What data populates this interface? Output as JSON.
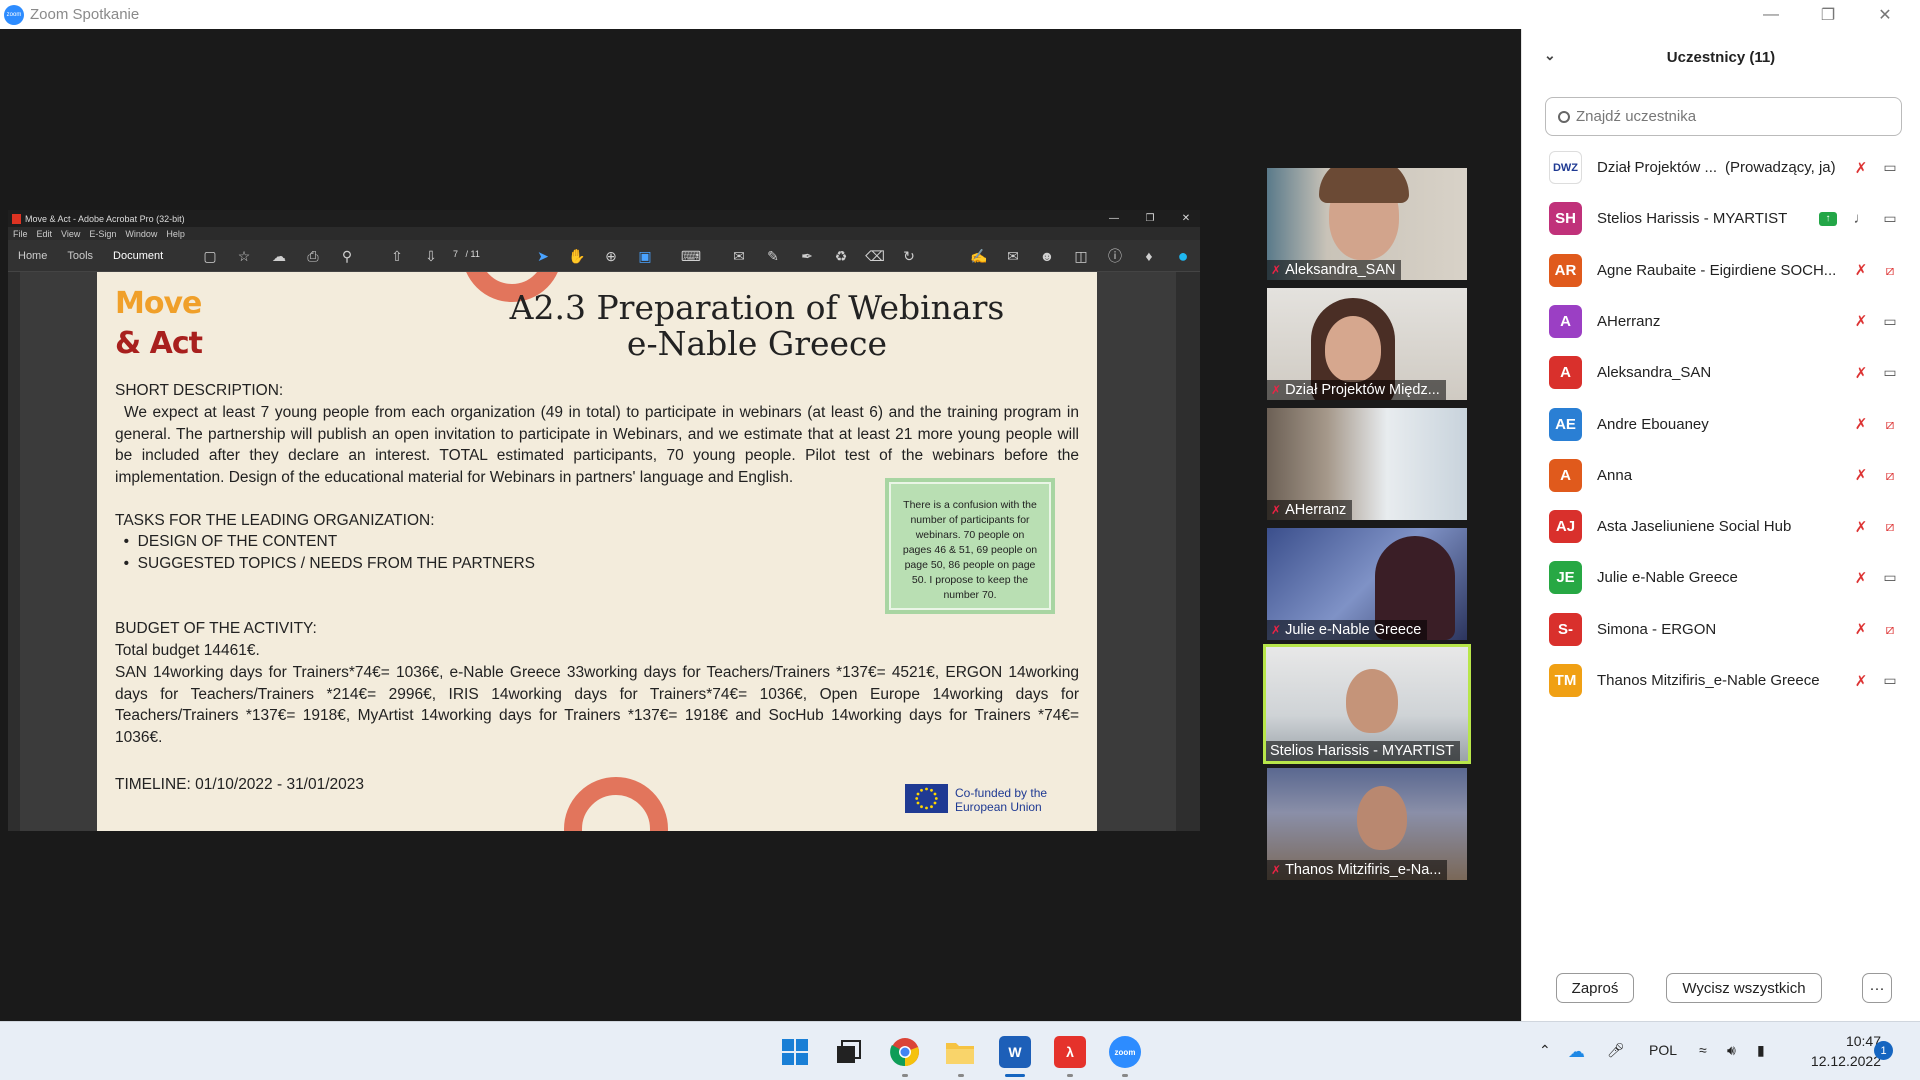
{
  "zoom_window": {
    "title": "Zoom Spotkanie",
    "logo_text": "zoom"
  },
  "acrobat": {
    "window_title": "Move & Act - Adobe Acrobat Pro (32-bit)",
    "menu": [
      "File",
      "Edit",
      "View",
      "E-Sign",
      "Window",
      "Help"
    ],
    "tabs": [
      "Home",
      "Tools",
      "Document"
    ],
    "active_tab": "Document",
    "page_current": "7",
    "page_total": "/ 11"
  },
  "slide": {
    "logo_line1": "Move",
    "logo_line2": "& Act",
    "title_line1": "A2.3 Preparation of Webinars",
    "title_line2": "e-Nable Greece",
    "short_description_heading": "SHORT DESCRIPTION:",
    "short_description": "We expect at least 7 young people from each organization (49 in total) to participate in webinars (at least 6) and the training program in general. The partnership will publish an open invitation to participate in Webinars, and we estimate that at least 21 more young people will be included after they declare an interest. TOTAL estimated participants, 70 young people. Pilot test of the webinars before the implementation. Design of the educational material for Webinars in partners' language and English.",
    "tasks_heading": "TASKS FOR THE LEADING ORGANIZATION:",
    "tasks": [
      "DESIGN OF THE CONTENT",
      "SUGGESTED TOPICS / NEEDS FROM THE PARTNERS"
    ],
    "budget_heading": "BUDGET OF THE ACTIVITY:",
    "budget_total": "Total budget 14461€.",
    "budget_detail": "SAN 14working days for Trainers*74€= 1036€, e-Nable Greece 33working days for Teachers/Trainers *137€= 4521€, ERGON 14working days for Teachers/Trainers *214€= 2996€, IRIS 14working days for Trainers*74€= 1036€, Open Europe 14working days for Teachers/Trainers *137€= 1918€, MyArtist 14working days for Trainers *137€= 1918€ and SocHub 14working days for Trainers *74€= 1036€.",
    "timeline": "TIMELINE: 01/10/2022 - 31/01/2023",
    "note": "There is a confusion with the number of participants for webinars. 70 people on pages 46 & 51, 69 people on page 50, 86 people on page 50. I propose to keep the number 70.",
    "eu_line1": "Co-funded by the",
    "eu_line2": "European Union"
  },
  "video_tiles": [
    {
      "name": "Aleksandra_SAN",
      "muted": true
    },
    {
      "name": "Dział Projektów Międz...",
      "muted": true
    },
    {
      "name": "AHerranz",
      "muted": true
    },
    {
      "name": "Julie e-Nable Greece",
      "muted": true
    },
    {
      "name": "Stelios Harissis - MYARTIST",
      "muted": false
    },
    {
      "name": "Thanos Mitzifiris_e-Na...",
      "muted": true
    }
  ],
  "participants_panel": {
    "title": "Uczestnicy (11)",
    "search_placeholder": "Znajdź uczestnika",
    "participants": [
      {
        "initials": "DWZ",
        "name": "Dział Projektów ...",
        "role": "(Prowadzący, ja)",
        "color": "#ffffff",
        "mic": "muted",
        "cam": "on"
      },
      {
        "initials": "SH",
        "name": "Stelios Harissis - MYARTIST",
        "color": "#c0317a",
        "mic": "on",
        "cam": "on",
        "sharing": true
      },
      {
        "initials": "AR",
        "name": "Agne Raubaite - Eigirdiene SOCH...",
        "color": "#e05a1c",
        "mic": "muted",
        "cam": "off"
      },
      {
        "initials": "A",
        "name": "AHerranz",
        "color": "#9b3fc4",
        "mic": "muted",
        "cam": "on"
      },
      {
        "initials": "A",
        "name": "Aleksandra_SAN",
        "color": "#d9302c",
        "mic": "muted",
        "cam": "on"
      },
      {
        "initials": "AE",
        "name": "Andre Ebouaney",
        "color": "#2a7fd4",
        "mic": "muted",
        "cam": "off"
      },
      {
        "initials": "A",
        "name": "Anna",
        "color": "#e05a1c",
        "mic": "muted",
        "cam": "off"
      },
      {
        "initials": "AJ",
        "name": "Asta Jaseliuniene Social Hub",
        "color": "#d9302c",
        "mic": "muted",
        "cam": "off"
      },
      {
        "initials": "JE",
        "name": "Julie e-Nable Greece",
        "color": "#27a844",
        "mic": "muted",
        "cam": "on"
      },
      {
        "initials": "S-",
        "name": "Simona - ERGON",
        "color": "#d9302c",
        "mic": "muted",
        "cam": "off"
      },
      {
        "initials": "TM",
        "name": "Thanos Mitzifiris_e-Nable Greece",
        "color": "#f0a014",
        "mic": "muted",
        "cam": "on"
      }
    ],
    "invite_label": "Zaproś",
    "mute_all_label": "Wycisz wszystkich",
    "more_label": "···"
  },
  "taskbar": {
    "apps": [
      "start",
      "task-view",
      "chrome",
      "file-explorer",
      "word",
      "acrobat",
      "zoom"
    ],
    "language": "POL",
    "time": "10:47",
    "date": "12.12.2022",
    "notifications": "1"
  }
}
